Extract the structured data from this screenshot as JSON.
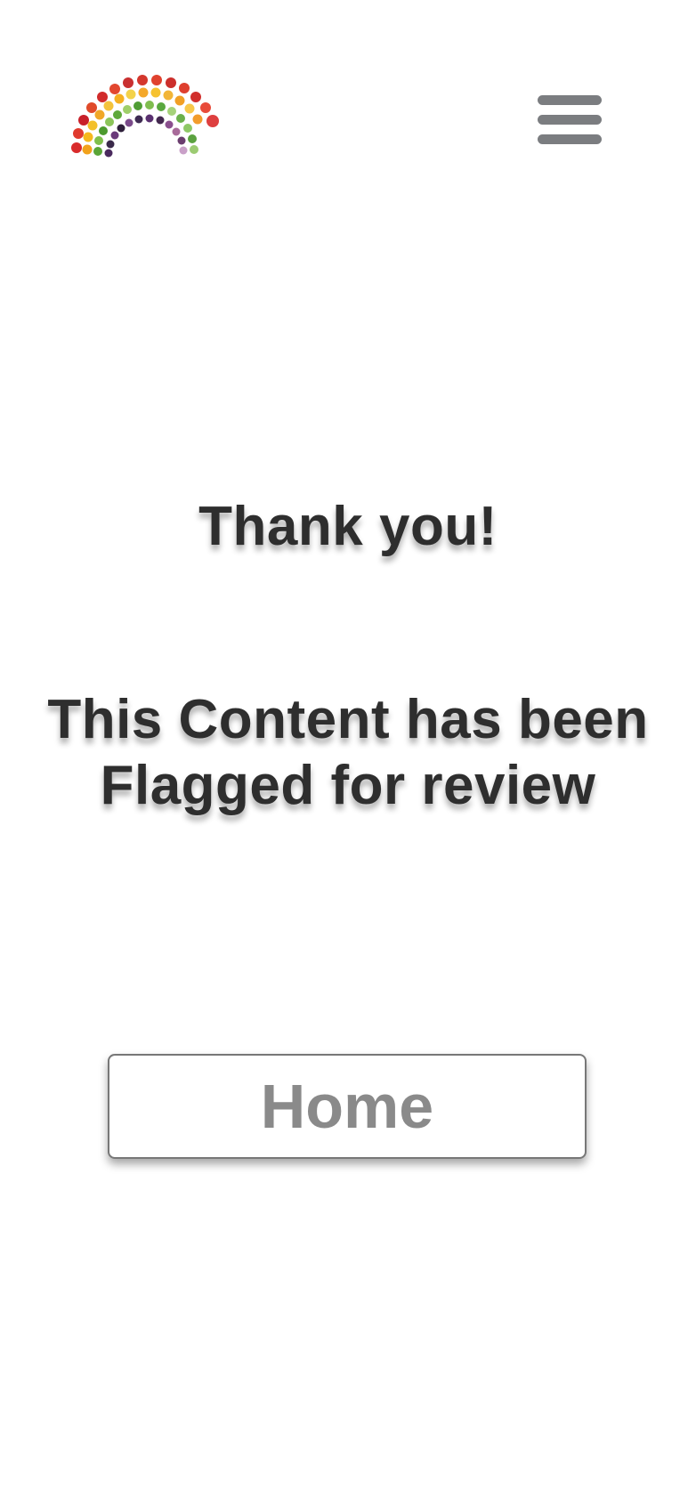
{
  "header": {
    "logo_icon": "fruit-vegetable-rainbow-logo",
    "menu_icon": "hamburger-menu-icon"
  },
  "main": {
    "title": "Thank you!",
    "message_line1": "This Content has been",
    "message_line2": "Flagged for review",
    "home_button_label": "Home"
  },
  "colors": {
    "text": "#2e2e2e",
    "menu_icon": "#7b7d80",
    "button_text": "#8a8a8a",
    "button_border": "#777777",
    "background": "#ffffff"
  }
}
